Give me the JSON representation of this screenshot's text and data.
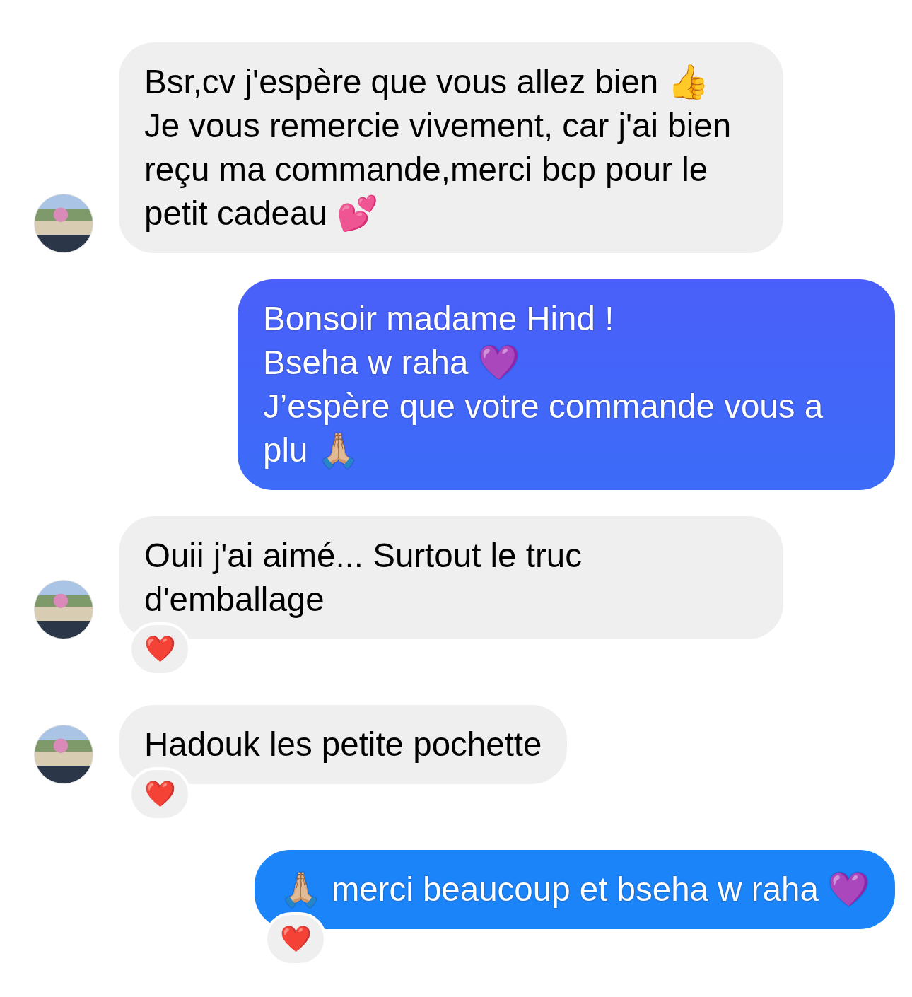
{
  "messages": [
    {
      "kind": "received",
      "text": "Bsr,cv j'espère que vous allez bien 👍\nJe vous remercie vivement, car j'ai bien reçu ma commande,merci bcp pour le petit cadeau 💕"
    },
    {
      "kind": "sent",
      "text": "Bonsoir madame Hind !\nBseha w raha 💜\nJ’espère que votre commande vous a plu 🙏🏼"
    },
    {
      "kind": "received",
      "text": "Ouii j'ai aimé... Surtout le truc d'emballage",
      "reaction": "❤️"
    },
    {
      "kind": "received",
      "text": "Hadouk les petite pochette",
      "reaction": "❤️"
    },
    {
      "kind": "sent",
      "text": "🙏🏼 merci beaucoup et bseha w raha 💜",
      "reaction": "❤️"
    }
  ]
}
